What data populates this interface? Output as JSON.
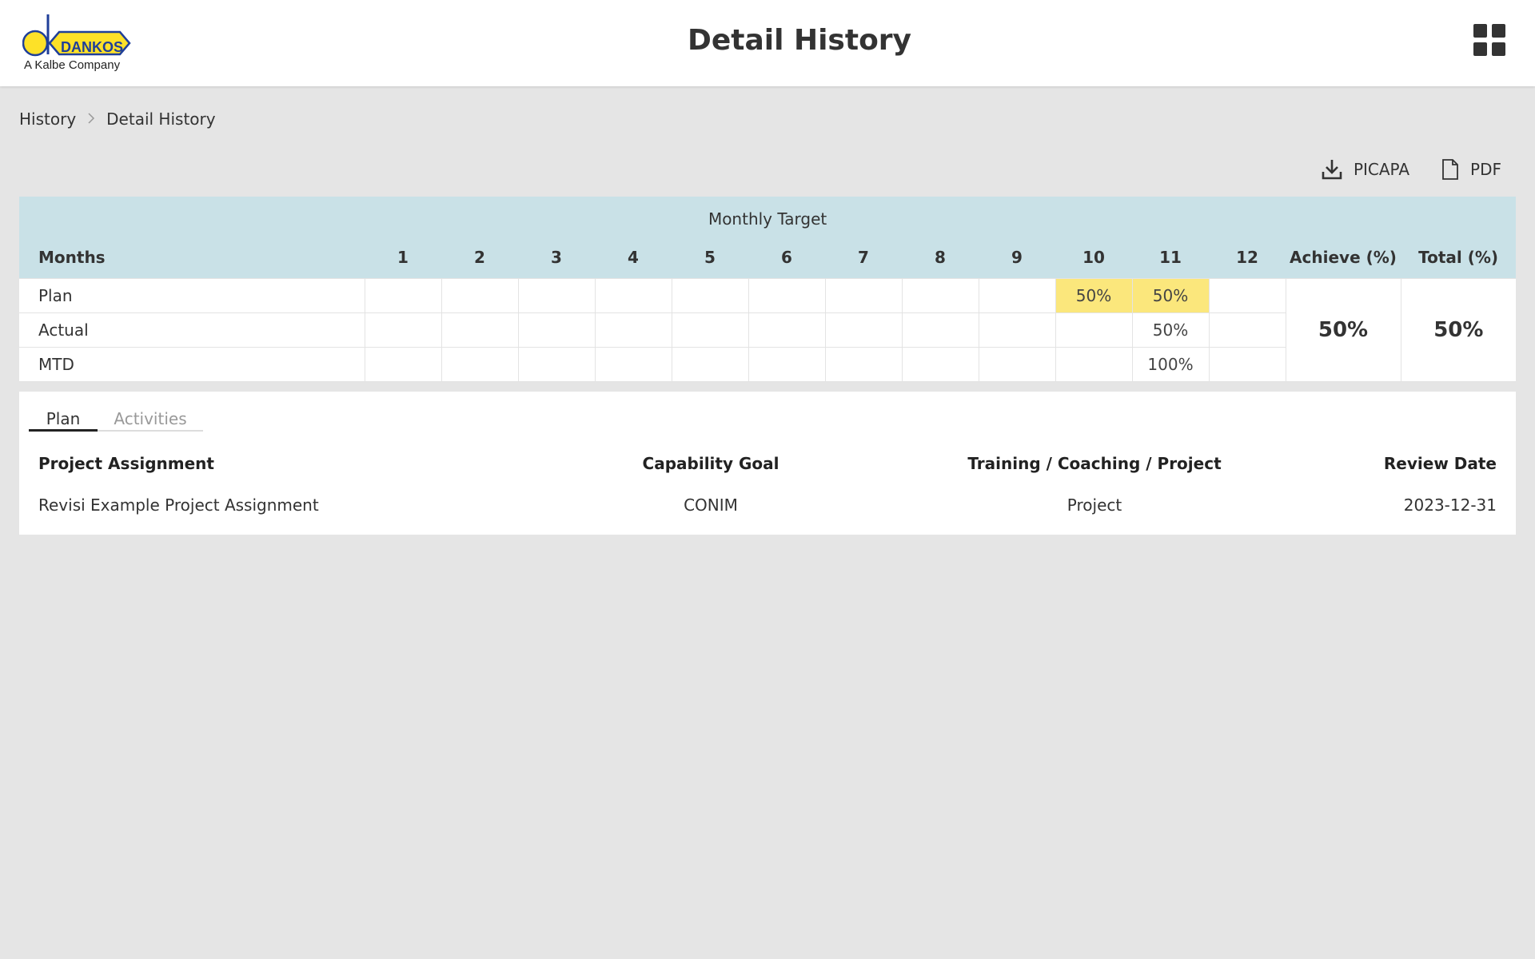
{
  "header": {
    "logo_text": "DANKOS",
    "logo_subtitle": "A Kalbe Company",
    "title": "Detail History",
    "menu_icon": "grid-menu-icon"
  },
  "breadcrumb": {
    "items": [
      "History",
      "Detail History"
    ]
  },
  "actions": {
    "picapa_label": "PICAPA",
    "picapa_icon": "download-icon",
    "pdf_label": "PDF",
    "pdf_icon": "file-icon"
  },
  "monthly_target": {
    "title": "Monthly Target",
    "columns": [
      "Months",
      "1",
      "2",
      "3",
      "4",
      "5",
      "6",
      "7",
      "8",
      "9",
      "10",
      "11",
      "12",
      "Achieve (%)",
      "Total (%)"
    ],
    "rows": [
      {
        "label": "Plan",
        "values": [
          "",
          "",
          "",
          "",
          "",
          "",
          "",
          "",
          "",
          "50%",
          "50%",
          ""
        ],
        "highlighted_months": [
          10,
          11
        ]
      },
      {
        "label": "Actual",
        "values": [
          "",
          "",
          "",
          "",
          "",
          "",
          "",
          "",
          "",
          "",
          "50%",
          ""
        ]
      },
      {
        "label": "MTD",
        "values": [
          "",
          "",
          "",
          "",
          "",
          "",
          "",
          "",
          "",
          "",
          "100%",
          ""
        ]
      }
    ],
    "achieve": "50%",
    "total": "50%",
    "colors": {
      "header_bg": "#c9e1e7",
      "highlight": "#fbe77c"
    }
  },
  "plan_panel": {
    "tabs": [
      {
        "label": "Plan",
        "active": true
      },
      {
        "label": "Activities",
        "active": false
      }
    ],
    "headers": [
      "Project Assignment",
      "Capability Goal",
      "Training / Coaching / Project",
      "Review Date"
    ],
    "rows": [
      [
        "Revisi Example Project Assignment",
        "CONIM",
        "Project",
        "2023-12-31"
      ]
    ]
  }
}
